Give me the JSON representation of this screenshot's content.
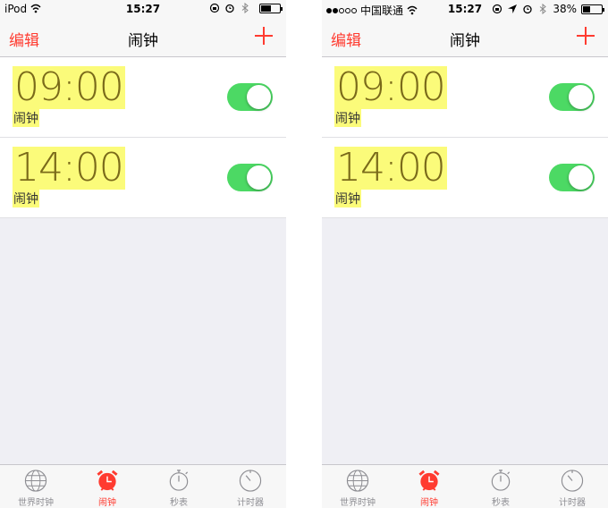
{
  "screens": [
    {
      "status": {
        "carrier": "iPod",
        "time": "15:27",
        "battery_text": "",
        "battery_level": 0.5
      },
      "nav": {
        "edit": "编辑",
        "title": "闹钟"
      },
      "alarms": [
        {
          "time": "09:00",
          "label": "闹钟",
          "on": true
        },
        {
          "time": "14:00",
          "label": "闹钟",
          "on": true
        }
      ],
      "tabs": [
        {
          "label": "世界时钟",
          "icon": "globe-icon"
        },
        {
          "label": "闹钟",
          "icon": "alarm-clock-icon",
          "active": true
        },
        {
          "label": "秒表",
          "icon": "stopwatch-icon"
        },
        {
          "label": "计时器",
          "icon": "timer-icon"
        }
      ]
    },
    {
      "status": {
        "carrier": "中国联通",
        "time": "15:27",
        "battery_text": "38%",
        "battery_level": 0.38
      },
      "nav": {
        "edit": "编辑",
        "title": "闹钟"
      },
      "alarms": [
        {
          "time": "09:00",
          "label": "闹钟",
          "on": true
        },
        {
          "time": "14:00",
          "label": "闹钟",
          "on": true
        }
      ],
      "tabs": [
        {
          "label": "世界时钟",
          "icon": "globe-icon"
        },
        {
          "label": "闹钟",
          "icon": "alarm-clock-icon",
          "active": true
        },
        {
          "label": "秒表",
          "icon": "stopwatch-icon"
        },
        {
          "label": "计时器",
          "icon": "timer-icon"
        }
      ]
    }
  ],
  "colors": {
    "accent": "#ff3b30",
    "switch_on": "#4cd964",
    "highlight": "#fbfb7a"
  }
}
